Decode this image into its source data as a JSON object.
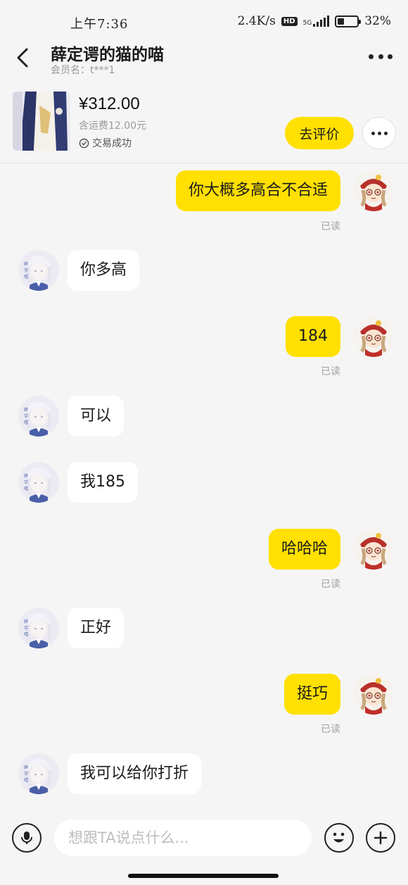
{
  "status_bar": {
    "time": "上午7:36",
    "network_speed": "2.4K/s",
    "hd_badge": "HD",
    "network_type": "5G",
    "battery_level_percent": 32,
    "battery_text": "32%"
  },
  "header": {
    "title": "薛定谔的猫的喵",
    "member_name": "会员名：t***1"
  },
  "product": {
    "price": "¥312.00",
    "shipping": "含运费12.00元",
    "status": "交易成功",
    "review_button": "去评价"
  },
  "messages": [
    {
      "from": "me",
      "text": "你大概多高合不合适",
      "read": "已读"
    },
    {
      "from": "them",
      "text": "你多高"
    },
    {
      "from": "me",
      "text": "184",
      "read": "已读"
    },
    {
      "from": "them",
      "text": "可以"
    },
    {
      "from": "them",
      "text": "我185"
    },
    {
      "from": "me",
      "text": "哈哈哈",
      "read": "已读"
    },
    {
      "from": "them",
      "text": "正好"
    },
    {
      "from": "me",
      "text": "挺巧",
      "read": "已读"
    },
    {
      "from": "them",
      "text": "我可以给你打折"
    }
  ],
  "input": {
    "placeholder": "想跟TA说点什么..."
  },
  "colors": {
    "accent_yellow": "#ffe000",
    "background": "#f5f5f5",
    "bubble_them": "#ffffff",
    "read_text": "#a0a0a0"
  },
  "icons": {
    "back": "chevron-left-icon",
    "more": "more-dots-icon",
    "mic": "microphone-icon",
    "emoji": "smiley-icon",
    "plus": "plus-icon",
    "check": "check-circle-icon"
  }
}
